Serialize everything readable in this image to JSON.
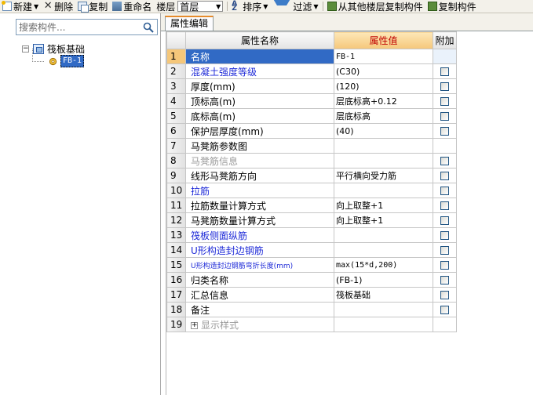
{
  "toolbar": {
    "new_label": "新建",
    "delete_label": "删除",
    "copy_label": "复制",
    "rename_label": "重命名",
    "floor_label": "楼层",
    "floor_value": "首层",
    "sort_label": "排序",
    "filter_label": "过滤",
    "copy_from_floor_label": "从其他楼层复制构件",
    "copy_component_label": "复制构件"
  },
  "left_panel": {
    "search_placeholder": "搜索构件...",
    "tree": {
      "root_label": "筏板基础",
      "child_label": "FB-1"
    }
  },
  "right_panel": {
    "tab_label": "属性编辑",
    "grid": {
      "headers": {
        "name": "属性名称",
        "value": "属性值",
        "extra": "附加"
      },
      "rows": [
        {
          "num": "1",
          "name": "名称",
          "value": "FB-1",
          "checkbox": false
        },
        {
          "num": "2",
          "name": "混凝土强度等级",
          "value": "(C30)",
          "checkbox": true
        },
        {
          "num": "3",
          "name": "厚度(mm)",
          "value": "(120)",
          "checkbox": true
        },
        {
          "num": "4",
          "name": "顶标高(m)",
          "value": "层底标高+0.12",
          "checkbox": true
        },
        {
          "num": "5",
          "name": "底标高(m)",
          "value": "层底标高",
          "checkbox": true
        },
        {
          "num": "6",
          "name": "保护层厚度(mm)",
          "value": "(40)",
          "checkbox": true
        },
        {
          "num": "7",
          "name": "马凳筋参数图",
          "value": "",
          "checkbox": false
        },
        {
          "num": "8",
          "name": "马凳筋信息",
          "value": "",
          "checkbox": true
        },
        {
          "num": "9",
          "name": "线形马凳筋方向",
          "value": "平行横向受力筋",
          "checkbox": true
        },
        {
          "num": "10",
          "name": "拉筋",
          "value": "",
          "checkbox": true
        },
        {
          "num": "11",
          "name": "拉筋数量计算方式",
          "value": "向上取整+1",
          "checkbox": true
        },
        {
          "num": "12",
          "name": "马凳筋数量计算方式",
          "value": "向上取整+1",
          "checkbox": true
        },
        {
          "num": "13",
          "name": "筏板侧面纵筋",
          "value": "",
          "checkbox": true
        },
        {
          "num": "14",
          "name": "U形构造封边钢筋",
          "value": "",
          "checkbox": true
        },
        {
          "num": "15",
          "name": "U形构造封边钢筋弯折长度(mm)",
          "value": "max(15*d,200)",
          "checkbox": true
        },
        {
          "num": "16",
          "name": "归类名称",
          "value": "(FB-1)",
          "checkbox": true
        },
        {
          "num": "17",
          "name": "汇总信息",
          "value": "筏板基础",
          "checkbox": true
        },
        {
          "num": "18",
          "name": "备注",
          "value": "",
          "checkbox": true
        },
        {
          "num": "19",
          "name": "显示样式",
          "value": "",
          "checkbox": false
        }
      ]
    }
  }
}
